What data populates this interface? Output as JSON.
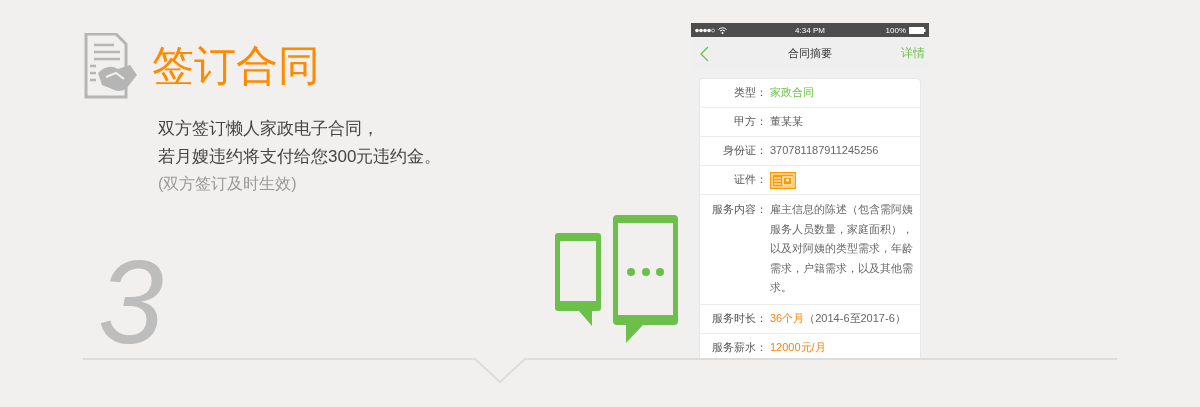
{
  "feature": {
    "step": "3",
    "title": "签订合同",
    "description_lines": [
      "双方签订懒人家政电子合同，",
      "若月嫂违约将支付给您300元违约金。"
    ],
    "note": "(双方签订及时生效)"
  },
  "phone": {
    "status_bar": {
      "time": "4:34 PM",
      "battery": "100%"
    },
    "nav": {
      "title": "合同摘要",
      "action": "详情"
    },
    "fields": [
      {
        "label": "类型：",
        "kind": "tag",
        "value": "家政合同"
      },
      {
        "label": "甲方：",
        "kind": "text",
        "value": "董某某"
      },
      {
        "label": "身份证：",
        "kind": "text",
        "value": "370781187911245256"
      },
      {
        "label": "证件：",
        "kind": "id_card"
      },
      {
        "label": "服务内容：",
        "kind": "text",
        "value": "雇主信息的陈述（包含需阿姨服务人员数量，家庭面积），以及对阿姨的类型需求，年龄需求，户籍需求，以及其他需求。"
      },
      {
        "label": "服务时长：",
        "kind": "highlight",
        "value": "36个月",
        "note": "（2014-6至2017-6）"
      },
      {
        "label": "服务薪水：",
        "kind": "highlight",
        "value": "12000元/月"
      }
    ]
  }
}
